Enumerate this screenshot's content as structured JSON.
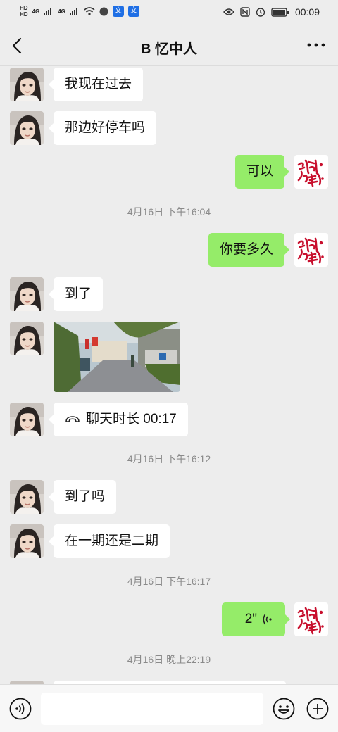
{
  "status_bar": {
    "left": {
      "hd1": "HD",
      "hd2": "HD",
      "sig1": "4G",
      "sig2": "4G",
      "app1": "文",
      "app2": "文"
    },
    "icons_left": [
      "signal-icon",
      "wifi-icon",
      "browser-icon"
    ],
    "icons_right": [
      "eye-icon",
      "nfc-icon",
      "alarm-icon",
      "battery-icon"
    ],
    "time": "00:09"
  },
  "nav": {
    "title": "B 忆中人",
    "back_icon": "back-arrow-icon",
    "more_icon": "more-dots-icon"
  },
  "messages": [
    {
      "side": "left",
      "text": "我现在过去"
    },
    {
      "side": "left",
      "text": "那边好停车吗"
    },
    {
      "side": "right",
      "text": "可以"
    },
    {
      "timestamp": "4月16日 下午16:04"
    },
    {
      "side": "right",
      "text": "你要多久"
    },
    {
      "side": "left",
      "text": "到了"
    },
    {
      "side": "left",
      "type": "image"
    },
    {
      "side": "left",
      "type": "call",
      "text": "聊天时长 00:17",
      "icon": "phone-hangup-icon"
    },
    {
      "timestamp": "4月16日 下午16:12"
    },
    {
      "side": "left",
      "text": "到了吗"
    },
    {
      "side": "left",
      "text": "在一期还是二期"
    },
    {
      "timestamp": "4月16日 下午16:17"
    },
    {
      "side": "right",
      "type": "voice",
      "text": "2\"",
      "icon": "voice-wave-icon"
    },
    {
      "timestamp": "4月16日 晚上22:19"
    }
  ],
  "self_avatar": {
    "text": "诚信"
  },
  "input_bar": {
    "voice_icon": "voice-input-icon",
    "emoji_icon": "emoji-icon",
    "plus_icon": "plus-icon"
  },
  "colors": {
    "background": "#ededed",
    "out_bubble": "#95ec69",
    "in_bubble": "#ffffff",
    "avatar_seal": "#c8102e"
  }
}
